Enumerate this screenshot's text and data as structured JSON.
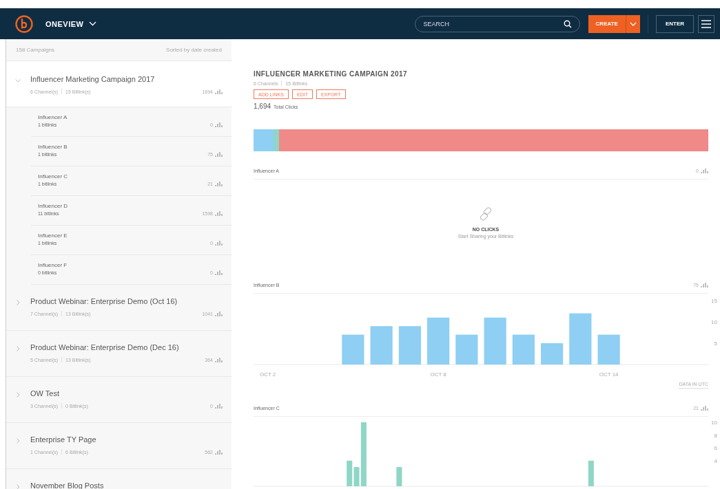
{
  "header": {
    "app_name": "ONEVIEW",
    "search": {
      "placeholder": "SEARCH"
    },
    "create_button": "CREATE",
    "enter_button": "ENTER"
  },
  "sidebar": {
    "count": "158 Campaigns",
    "sort": "Sorted by date created",
    "campaigns": [
      {
        "name": "Influencer Marketing Campaign 2017",
        "channels": "6 Channel(s)",
        "bitlinks": "15 Bitlink(s)",
        "clicks": "1694",
        "expanded": true,
        "children": [
          {
            "name": "Influencer A",
            "bitlinks": "1 bitlinks",
            "clicks": "0"
          },
          {
            "name": "Influencer B",
            "bitlinks": "1 bitlinks",
            "clicks": "75"
          },
          {
            "name": "Influencer C",
            "bitlinks": "1 bitlinks",
            "clicks": "21"
          },
          {
            "name": "Influencer D",
            "bitlinks": "11 bitlinks",
            "clicks": "1598"
          },
          {
            "name": "Influencer E",
            "bitlinks": "1 bitlinks",
            "clicks": "0"
          },
          {
            "name": "Influencer F",
            "bitlinks": "0 bitlinks",
            "clicks": "0"
          }
        ]
      },
      {
        "name": "Product Webinar: Enterprise Demo (Oct 16)",
        "channels": "7 Channel(s)",
        "bitlinks": "13 Bitlink(s)",
        "clicks": "1041",
        "expanded": false
      },
      {
        "name": "Product Webinar: Enterprise Demo (Dec 16)",
        "channels": "5 Channel(s)",
        "bitlinks": "13 Bitlink(s)",
        "clicks": "364",
        "expanded": false
      },
      {
        "name": "OW Test",
        "channels": "3 Channel(s)",
        "bitlinks": "0 Bitlink(s)",
        "clicks": "0",
        "expanded": false
      },
      {
        "name": "Enterprise TY Page",
        "channels": "1 Channel(s)",
        "bitlinks": "6 Bitlink(s)",
        "clicks": "562",
        "expanded": false
      },
      {
        "name": "November Blog Posts",
        "expanded": false
      }
    ]
  },
  "detail": {
    "title": "INFLUENCER MARKETING CAMPAIGN 2017",
    "channels": "6 Channels",
    "bitlinks": "15 Bitlinks",
    "actions": [
      "ADD LINKS",
      "EDIT",
      "EXPORT"
    ],
    "total": "1,694",
    "total_label": "Total Clicks",
    "click_bar": [
      {
        "color": "#8ecff3"
      },
      {
        "color": "#8fd6c6"
      },
      {
        "color": "#ef8a88"
      }
    ],
    "sections": [
      {
        "kind": "empty",
        "name": "Influencer A",
        "clicks": "0",
        "empty_title": "NO CLICKS",
        "empty_text": "Start Sharing your Bitlinks"
      },
      {
        "kind": "chart",
        "name": "Influencer B",
        "clicks": "75",
        "note": "DATA IN UTC",
        "chart_data": {
          "type": "bar",
          "categories": [
            "OCT 2",
            null,
            null,
            null,
            null,
            null,
            "OCT 8",
            null,
            null,
            null,
            null,
            null,
            "OCT 14",
            null,
            null,
            null
          ],
          "series": [
            {
              "color": "#8ecff3",
              "values": [
                null,
                null,
                null,
                7,
                9,
                9,
                11,
                7,
                11,
                7,
                5,
                12,
                7,
                null,
                null,
                null
              ]
            }
          ],
          "yticks": [
            5,
            10,
            15
          ],
          "ylim": [
            0,
            15
          ]
        }
      },
      {
        "kind": "chart",
        "name": "Influencer C",
        "clicks": "21",
        "chart_data": {
          "type": "bar",
          "series": [
            {
              "color": "#8fd6c6",
              "values": [
                null,
                null,
                null,
                null,
                null,
                null,
                null,
                null,
                null,
                null,
                null,
                null,
                null,
                4,
                3,
                10,
                null,
                null,
                null,
                null,
                3,
                null,
                null,
                null,
                null,
                null,
                null,
                null,
                null,
                null,
                null,
                null,
                null,
                null,
                null,
                null,
                null,
                null,
                null,
                null,
                null,
                null,
                null,
                null,
                null,
                null,
                null,
                4,
                null,
                null,
                null,
                null,
                null,
                null,
                null,
                null,
                null,
                null,
                null,
                null,
                null,
                null,
                null,
                null
              ]
            }
          ],
          "yticks": [
            4,
            6,
            8,
            10
          ],
          "ylim": [
            0,
            10
          ]
        }
      }
    ]
  }
}
